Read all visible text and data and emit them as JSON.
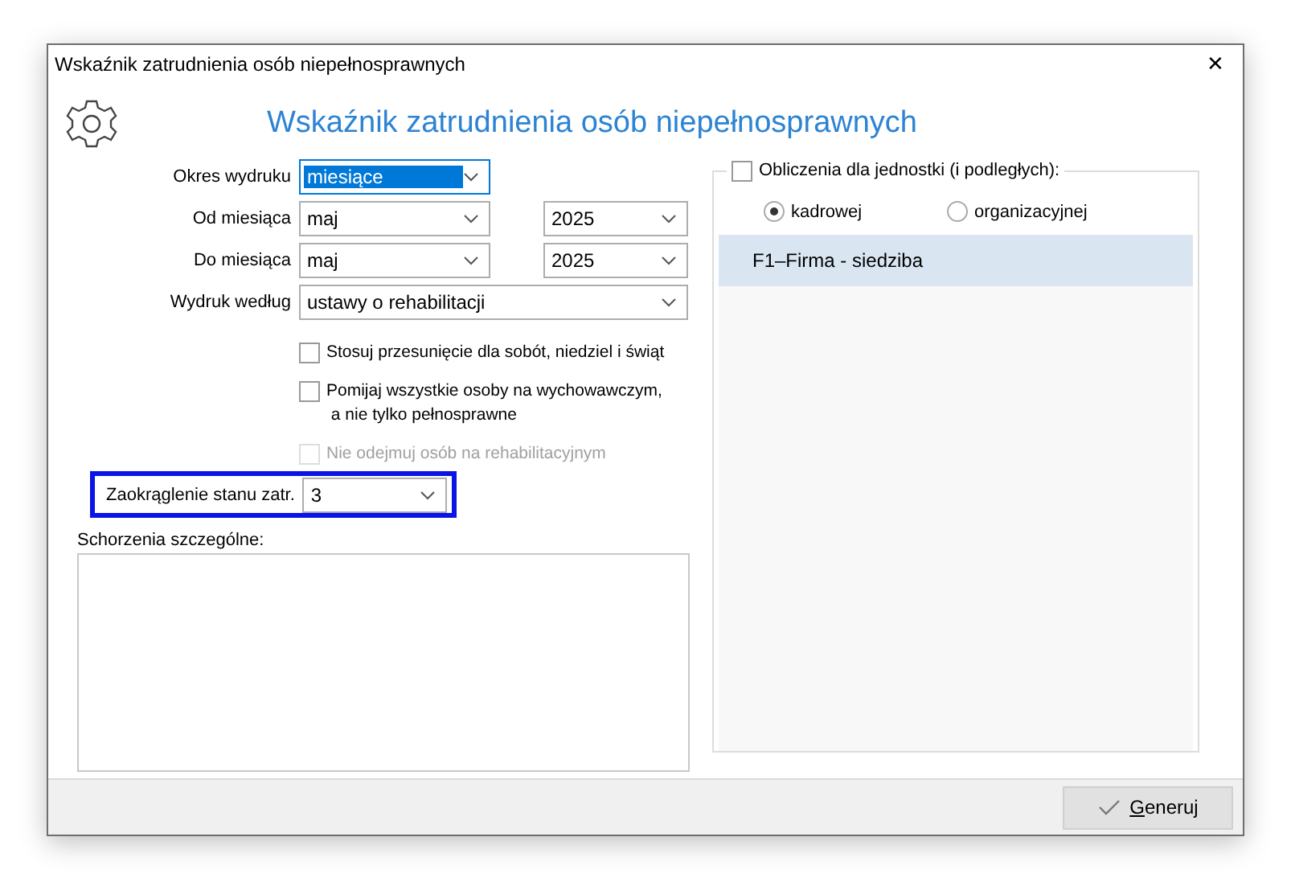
{
  "window": {
    "title": "Wskaźnik zatrudnienia osób niepełnosprawnych",
    "close": "✕"
  },
  "heading": "Wskaźnik zatrudnienia osób niepełnosprawnych",
  "rows": [
    {
      "label": "Okres wydruku",
      "fields": [
        {
          "kind": "short",
          "value": "miesiące",
          "focused": true
        }
      ]
    },
    {
      "label": "Od miesiąca",
      "fields": [
        {
          "kind": "short",
          "value": "maj",
          "focused": false
        },
        {
          "kind": "year",
          "value": "2025",
          "focused": false
        }
      ]
    },
    {
      "label": "Do miesiąca",
      "fields": [
        {
          "kind": "short",
          "value": "maj",
          "focused": false
        },
        {
          "kind": "year",
          "value": "2025",
          "focused": false
        }
      ]
    },
    {
      "label": "Wydruk według",
      "fields": [
        {
          "kind": "wide",
          "value": "ustawy o rehabilitacji",
          "focused": false
        }
      ]
    }
  ],
  "checkboxes": [
    {
      "label": "Stosuj przesunięcie dla sobót, niedziel i świąt",
      "checked": false,
      "disabled": false
    },
    {
      "label": "Pomijaj wszystkie osoby na wychowawczym,\n a nie tylko pełnosprawne",
      "checked": false,
      "disabled": false
    },
    {
      "label": "Nie odejmuj osób na rehabilitacyjnym",
      "checked": false,
      "disabled": true
    }
  ],
  "rounding": {
    "label": "Zaokrąglenie stanu zatr.",
    "value": "3",
    "highlighted": true
  },
  "notes": {
    "label": "Schorzenia szczególne:"
  },
  "units": {
    "label": "Obliczenia dla jednostki (i podległych):",
    "checked": false,
    "radios": [
      {
        "label": "kadrowej",
        "selected": true
      },
      {
        "label": "organizacyjnej",
        "selected": false
      }
    ],
    "items": [
      {
        "label": "F1–Firma - siedziba",
        "selected": true
      }
    ]
  },
  "footer": {
    "button": "Generuj"
  }
}
